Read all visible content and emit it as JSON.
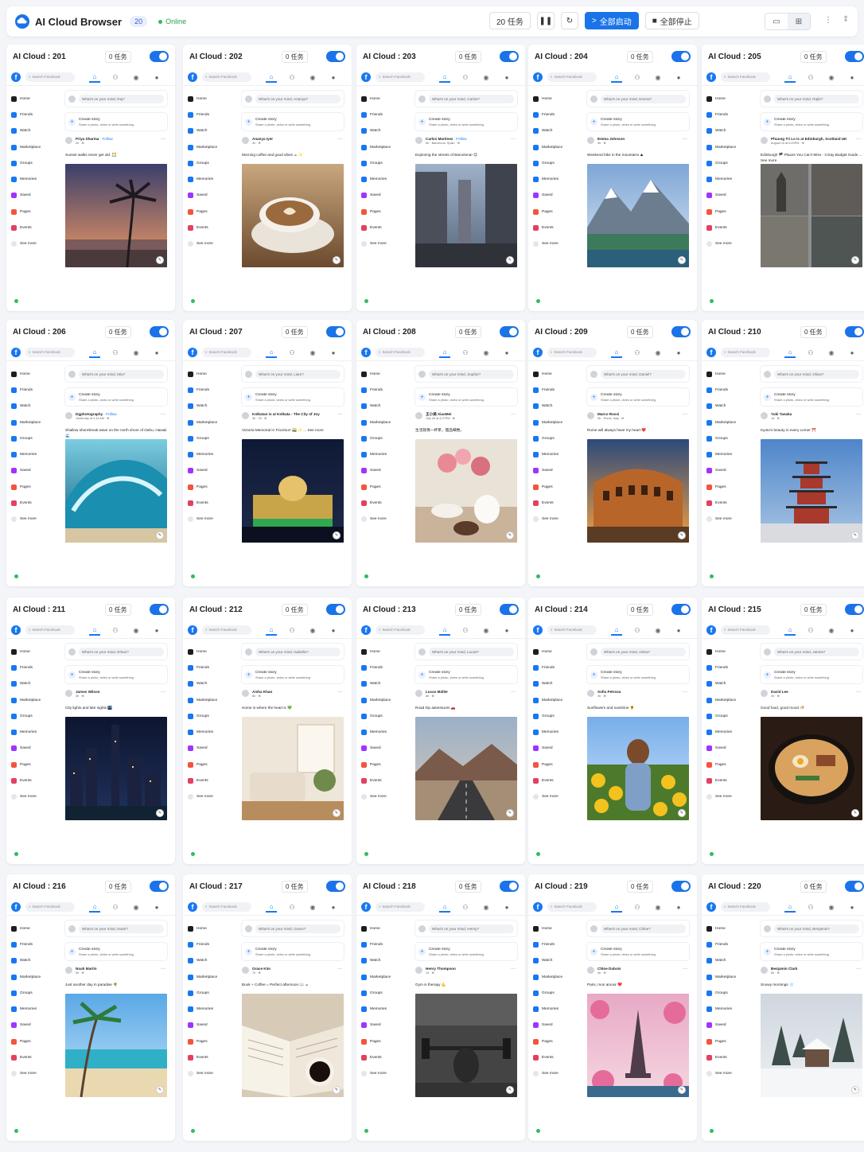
{
  "app": {
    "title": "AI Cloud Browser",
    "count": "20",
    "status": "Online",
    "task_count_label": "20 任务",
    "start_all_label": "全部启动",
    "stop_all_label": "全部停止",
    "colors": {
      "accent": "#1a73e8",
      "online": "#2ebd5b",
      "facebook": "#1877f2"
    }
  },
  "facebook": {
    "search_placeholder": "Search Facebook",
    "story_title": "Create story",
    "story_subtitle": "Share a photo, video or write something.",
    "sidebar": [
      "Home",
      "Friends",
      "Watch",
      "Marketplace",
      "Groups",
      "Memories",
      "Saved",
      "Pages",
      "Events",
      "See more"
    ]
  },
  "browsers": [
    {
      "title": "AI Cloud : 201",
      "tasks": "0 任务",
      "compose": "What's on your mind, Raj?",
      "author": "Priya Sharma",
      "follow": "· Follow",
      "meta": "2h · ⊕",
      "caption": "Sunset walks never get old. 🌅",
      "scene": "sunset-palm"
    },
    {
      "title": "AI Cloud : 202",
      "tasks": "0 任务",
      "compose": "What's on your mind, Ananya?",
      "author": "Ananya Iyer",
      "follow": "",
      "meta": "4h · ⊕",
      "caption": "Morning coffee and good vibes ☕ ✨",
      "scene": "coffee"
    },
    {
      "title": "AI Cloud : 203",
      "tasks": "0 任务",
      "compose": "What's on your mind, Carlos?",
      "author": "Carlos Martinez",
      "follow": "· Follow",
      "meta": "6h · Barcelona, Spain · ⊕",
      "caption": "Exploring the streets of Barcelona! 😊",
      "scene": "street"
    },
    {
      "title": "AI Cloud : 204",
      "tasks": "0 任务",
      "compose": "What's on your mind, Emma?",
      "author": "Emma Johnson",
      "follow": "",
      "meta": "3h · ⊕",
      "caption": "Weekend hike in the mountains ⛰",
      "scene": "mountain"
    },
    {
      "title": "AI Cloud : 205",
      "tasks": "0 任务",
      "compose": "What's on your mind, Rajib?",
      "author": "Phuong Tri Lo is at Edinburgh, Scotland UK",
      "follow": "",
      "meta": "August 10 at 6:20PM · ⊕",
      "caption": "Edinburgh 🏴 Places You Can't Miss - 3 Day Budget Guide ... See more",
      "scene": "castle"
    },
    {
      "title": "AI Cloud : 206",
      "tasks": "0 任务",
      "compose": "What's on your mind, Mia?",
      "author": "Dgphotography",
      "follow": "· Follow",
      "meta": "Yesterday at 2:14 AM · ⊕",
      "caption": "Shallow shorebreak wave on the north shore of Oahu, Hawaii 🌊",
      "scene": "wave"
    },
    {
      "title": "AI Cloud : 207",
      "tasks": "0 任务",
      "compose": "What's on your mind, Liam?",
      "author": "Kolkatan is at Kolkata - The City of Joy",
      "follow": "",
      "meta": "3h · 2h · ⊕",
      "caption": "Victoria Memorial in Tricolour! 🇮🇳 ✨ ... See more",
      "scene": "memorial"
    },
    {
      "title": "AI Cloud : 208",
      "tasks": "0 任务",
      "compose": "What's on your mind, Sophie?",
      "author": "王小美 XiaoMei",
      "follow": "",
      "meta": "July 26 at 4:27PM · ⊕",
      "caption": "生活就像一杯茶，慢品细尝。",
      "scene": "tea"
    },
    {
      "title": "AI Cloud : 209",
      "tasks": "0 任务",
      "compose": "What's on your mind, Daniel?",
      "author": "Marco Rossi",
      "follow": "",
      "meta": "5h · Rome, Italy · ⊕",
      "caption": "Rome will always have my heart ❤️",
      "scene": "colosseum"
    },
    {
      "title": "AI Cloud : 210",
      "tasks": "0 任务",
      "compose": "What's on your mind, Olivia?",
      "author": "Yuki Tanaka",
      "follow": "",
      "meta": "1d · ⊕",
      "caption": "Kyoto's beauty in every corner ⛩️",
      "scene": "pagoda"
    },
    {
      "title": "AI Cloud : 211",
      "tasks": "0 任务",
      "compose": "What's on your mind, Ethan?",
      "author": "James Wilson",
      "follow": "",
      "meta": "3h · ⊕",
      "caption": "City lights and late nights 🌃",
      "scene": "city"
    },
    {
      "title": "AI Cloud : 212",
      "tasks": "0 任务",
      "compose": "What's on your mind, Isabella?",
      "author": "Aisha Khan",
      "follow": "",
      "meta": "6h · ⊕",
      "caption": "Home is where the heart is 💚",
      "scene": "room"
    },
    {
      "title": "AI Cloud : 213",
      "tasks": "0 任务",
      "compose": "What's on your mind, Lucas?",
      "author": "Lucas Müller",
      "follow": "",
      "meta": "8h · ⊕",
      "caption": "Road trip adventures 🚗",
      "scene": "road"
    },
    {
      "title": "AI Cloud : 214",
      "tasks": "0 任务",
      "compose": "What's on your mind, Aisha?",
      "author": "Sofia Petrova",
      "follow": "",
      "meta": "3h · ⊕",
      "caption": "Sunflowers and sunshine 🌻",
      "scene": "sunflower"
    },
    {
      "title": "AI Cloud : 215",
      "tasks": "0 任务",
      "compose": "What's on your mind, James?",
      "author": "David Lee",
      "follow": "",
      "meta": "2h · ⊕",
      "caption": "Good food, good mood 🍜",
      "scene": "ramen"
    },
    {
      "title": "AI Cloud : 216",
      "tasks": "0 任务",
      "compose": "What's on your mind, Noah?",
      "author": "Noah Martin",
      "follow": "",
      "meta": "5h · ⊕",
      "caption": "Just another day in paradise 🌴",
      "scene": "beach"
    },
    {
      "title": "AI Cloud : 217",
      "tasks": "0 任务",
      "compose": "What's on your mind, Grace?",
      "author": "Grace Kim",
      "follow": "",
      "meta": "7h · ⊕",
      "caption": "Book + Coffee = Perfect afternoon 📖 ☕",
      "scene": "book"
    },
    {
      "title": "AI Cloud : 218",
      "tasks": "0 任务",
      "compose": "What's on your mind, Henry?",
      "author": "Henry Thompson",
      "follow": "",
      "meta": "1h · ⊕",
      "caption": "Gym is therapy 💪",
      "scene": "gym"
    },
    {
      "title": "AI Cloud : 219",
      "tasks": "0 任务",
      "compose": "What's on your mind, Chloe?",
      "author": "Chloe Dubois",
      "follow": "",
      "meta": "4h · ⊕",
      "caption": "Paris, mon amour ❤️",
      "scene": "paris"
    },
    {
      "title": "AI Cloud : 220",
      "tasks": "0 任务",
      "compose": "What's on your mind, Benjamin?",
      "author": "Benjamin Clark",
      "follow": "",
      "meta": "6h · ⊕",
      "caption": "Snowy mornings ❄️",
      "scene": "snow"
    }
  ]
}
